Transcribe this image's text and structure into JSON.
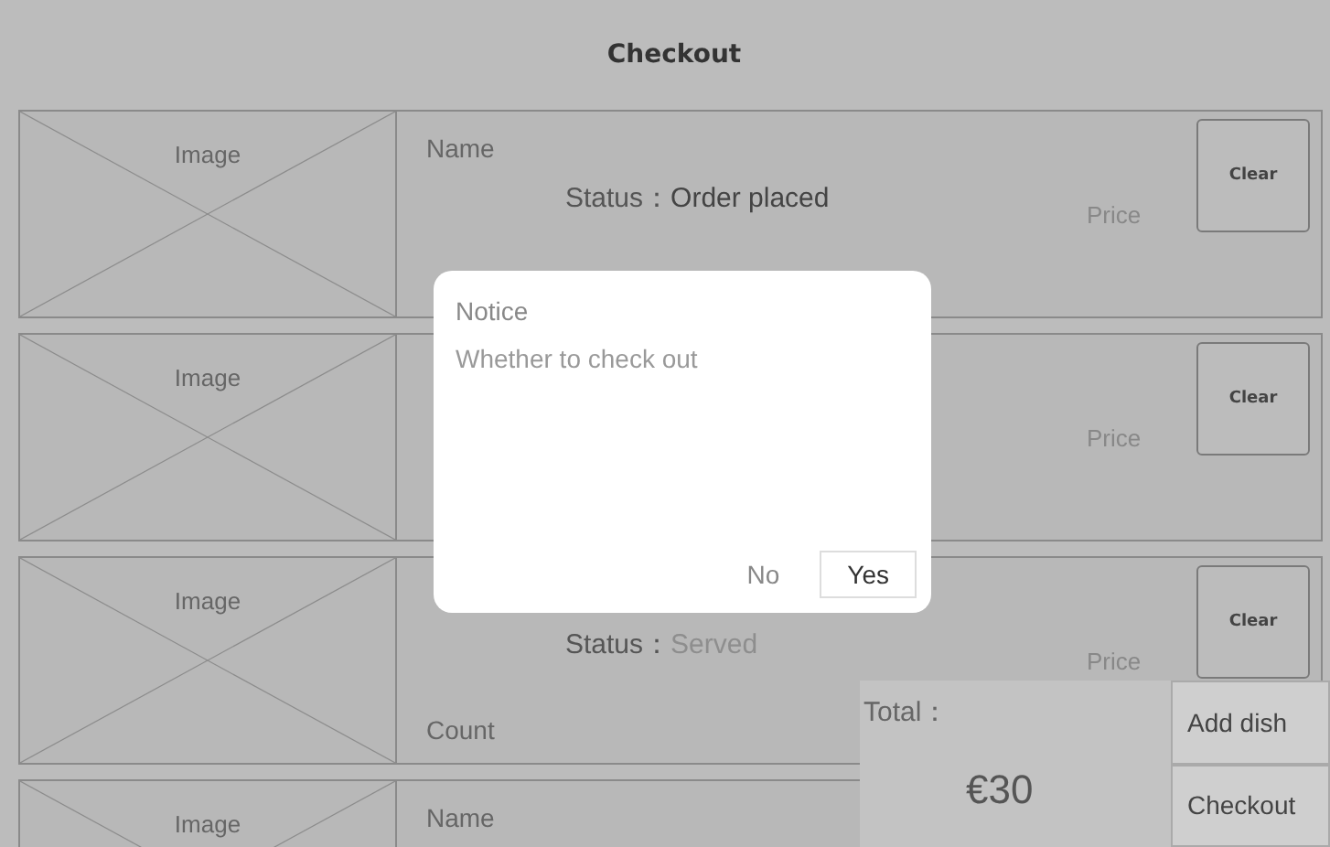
{
  "header": {
    "title": "Checkout"
  },
  "dishes": [
    {
      "image": "Image",
      "name": "Name",
      "status": {
        "label": "Status：",
        "value": "Order placed",
        "dimmed": false
      },
      "price": "Price",
      "button": "Clear"
    },
    {
      "image": "Image",
      "price": "Price",
      "button": "Clear"
    },
    {
      "image": "Image",
      "status": {
        "label": "Status：",
        "value": "Served",
        "dimmed": true
      },
      "count": "Count",
      "price": "Price",
      "button": "Clear"
    },
    {
      "image": "Image",
      "name": "Name"
    }
  ],
  "dialog": {
    "title": "Notice",
    "message": "Whether to check out",
    "buttons": [
      {
        "label": "No",
        "kind": "plain"
      },
      {
        "label": "Yes",
        "kind": "outlined"
      }
    ]
  },
  "summary": {
    "label": "Total：",
    "amount": "€30",
    "buttons": [
      "Add dish",
      "Checkout"
    ]
  }
}
